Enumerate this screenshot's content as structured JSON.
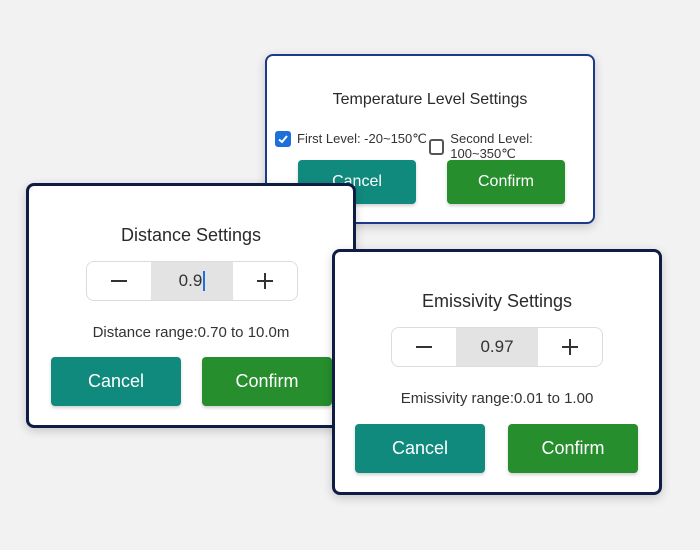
{
  "temperature_dialog": {
    "title": "Temperature Level Settings",
    "first_level": {
      "label": "First Level: -20~150℃",
      "checked": true
    },
    "second_level": {
      "label": "Second Level: 100~350℃",
      "checked": false
    },
    "cancel_label": "Cancel",
    "confirm_label": "Confirm"
  },
  "distance_dialog": {
    "title": "Distance Settings",
    "value": "0.9",
    "range_text": "Distance range:0.70 to 10.0m",
    "cancel_label": "Cancel",
    "confirm_label": "Confirm"
  },
  "emissivity_dialog": {
    "title": "Emissivity Settings",
    "value": "0.97",
    "range_text": "Emissivity range:0.01 to 1.00",
    "cancel_label": "Cancel",
    "confirm_label": "Confirm"
  },
  "icons": {
    "minus": "minus-icon",
    "plus": "plus-icon",
    "check": "checkmark-icon"
  },
  "colors": {
    "cancel": "#118a7e",
    "confirm": "#268e2d",
    "checkbox": "#1d6fd9",
    "dialog_border": "#0f1d45"
  }
}
